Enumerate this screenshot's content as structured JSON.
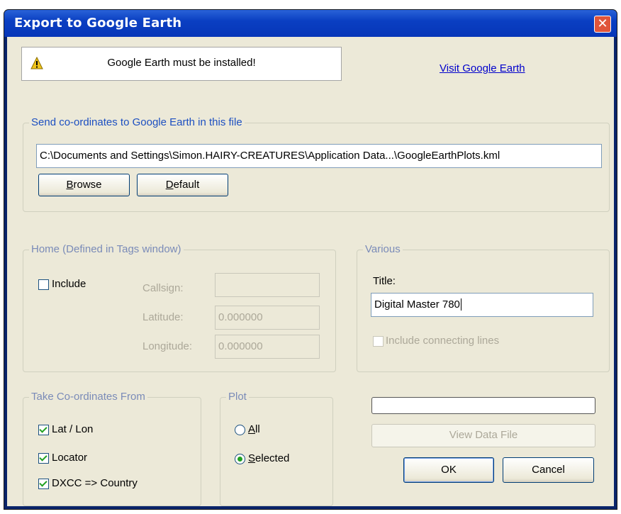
{
  "window": {
    "title": "Export to Google Earth",
    "close_glyph": "✕"
  },
  "warning": {
    "icon": "warning-icon",
    "text": "Google Earth must be installed!"
  },
  "link": {
    "label": "Visit Google Earth"
  },
  "file_group": {
    "label": "Send co-ordinates to Google Earth in this file",
    "path": "C:\\Documents and Settings\\Simon.HAIRY-CREATURES\\Application Data...\\GoogleEarthPlots.kml",
    "browse": {
      "mnemonic": "B",
      "rest": "rowse"
    },
    "default": {
      "mnemonic": "D",
      "rest": "efault"
    }
  },
  "home_group": {
    "label": "Home (Defined in Tags window)",
    "include_label": "Include",
    "include_checked": false,
    "callsign_label": "Callsign:",
    "callsign_value": "",
    "latitude_label": "Latitude:",
    "latitude_value": "0.000000",
    "longitude_label": "Longitude:",
    "longitude_value": "0.000000"
  },
  "various_group": {
    "label": "Various",
    "title_label": "Title:",
    "title_value": "Digital Master 780",
    "connect_label": "Include connecting lines",
    "connect_checked": false
  },
  "coords_group": {
    "label": "Take Co-ordinates From",
    "items": [
      {
        "label": "Lat / Lon",
        "checked": true
      },
      {
        "label": "Locator",
        "checked": true
      },
      {
        "label": "DXCC => Country",
        "checked": true
      }
    ]
  },
  "plot_group": {
    "label": "Plot",
    "all": {
      "mnemonic": "A",
      "rest": "ll",
      "selected": false
    },
    "selected": {
      "mnemonic": "S",
      "rest": "elected",
      "selected": true
    }
  },
  "progress": {
    "value": 0
  },
  "view_data_file_label": "View Data File",
  "ok_label": "OK",
  "cancel_label": "Cancel",
  "colors": {
    "title_bar": "#0736b8",
    "group_label": "#1c4fc1",
    "link": "#0000cc",
    "face": "#ece9d8"
  }
}
